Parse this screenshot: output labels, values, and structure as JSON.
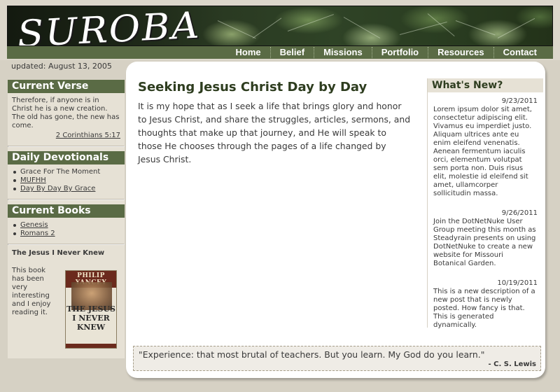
{
  "site": {
    "logo": "SUROBA",
    "updated": "updated: August 13, 2005"
  },
  "nav": [
    "Home",
    "Belief",
    "Missions",
    "Portfolio",
    "Resources",
    "Contact"
  ],
  "sidebar": {
    "verse": {
      "title": "Current Verse",
      "text": "Therefore, if anyone is in Christ he is a new creation. The old has gone, the new has come.",
      "reference": "2 Corinthians 5:17"
    },
    "devotionals": {
      "title": "Daily Devotionals",
      "items": [
        {
          "label": "Grace For The Moment",
          "link": false
        },
        {
          "label": "MUFHH",
          "link": true
        },
        {
          "label": "Day By Day By Grace",
          "link": true
        }
      ]
    },
    "books": {
      "title": "Current Books",
      "items": [
        "Genesis",
        "Romans 2"
      ],
      "featured_title": "The Jesus I Never Knew",
      "featured_desc": "This book has been very interesting and I enjoy reading it.",
      "cover_author": "PHILIP YANCEY",
      "cover_title": "THE JESUS I NEVER KNEW"
    }
  },
  "main": {
    "title": "Seeking Jesus Christ Day by Day",
    "intro": "It is my hope that as I seek a life that brings glory and honor to Jesus Christ, and share the struggles, articles, sermons, and thoughts that make up that journey, and He will speak to those He chooses through the pages of a life changed by Jesus Christ."
  },
  "whats_new": {
    "title": "What's New?",
    "items": [
      {
        "date": "9/23/2011",
        "text": "Lorem ipsum dolor sit amet, consectetur adipiscing elit. Vivamus eu imperdiet justo. Aliquam ultrices ante eu enim eleifend venenatis. Aenean fermentum iaculis orci, elementum volutpat sem porta non. Duis risus elit, molestie id eleifend sit amet, ullamcorper sollicitudin massa."
      },
      {
        "date": "9/26/2011",
        "text": "Join the DotNetNuke User Group meeting this month as Steadyrain presents on using DotNetNuke to create a new website for Missouri Botanical Garden."
      },
      {
        "date": "10/19/2011",
        "text": "This is a new description of a new post that is newly posted.  How fancy is that. This is generated dynamically."
      }
    ]
  },
  "quote": {
    "text": "\"Experience: that most brutal of teachers. But you learn. My God do you learn.\"",
    "author": "- C. S. Lewis"
  },
  "colors": {
    "accent": "#5a6b45",
    "background": "#d6d1c4",
    "panel": "#e6e1d5",
    "heading": "#2e3d1f"
  }
}
